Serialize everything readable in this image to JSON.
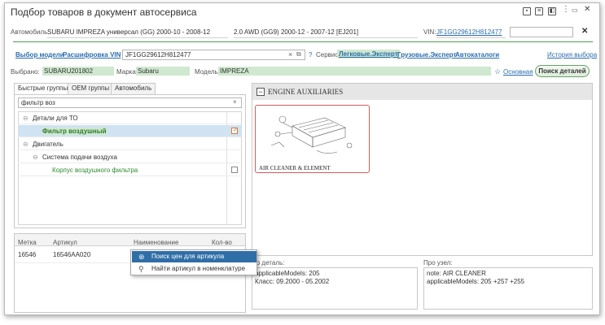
{
  "window": {
    "title": "Подбор товаров в документ автосервиса",
    "close_glyph": "✕"
  },
  "vehicle_row": {
    "car_label": "Автомобиль:",
    "car_value": "SUBARU IMPREZA универсал (GG) 2000-10 - 2008-12",
    "engine_value": "2.0 AWD (GG9) 2000-12 - 2007-12 [EJ201]",
    "vin_label": "VIN:",
    "vin_value": "JF1GG29612H812477",
    "close_glyph": "✕"
  },
  "search_row": {
    "select_model": "Выбор модели",
    "decode_vin": "Расшифровка VIN",
    "vin_input": "JF1GG29612H812477",
    "question": "?",
    "service_label": "Сервис:",
    "service_light": "Легковые.Эксперт",
    "service_trucks": "Грузовые.Эксперт",
    "autocatalogs": "Автокаталоги",
    "history": "История выбора"
  },
  "selection_row": {
    "chosen_label": "Выбрано:",
    "chosen_value": "SUBARU201802",
    "brand_label": "Марка:",
    "brand_value": "Subaru",
    "model_label": "Модель:",
    "model_value": "IMPREZA",
    "main_label": "Основная",
    "search_parts": "Поиск деталей"
  },
  "tabs": [
    {
      "label": "Быстрые группы"
    },
    {
      "label": "OEM группы"
    },
    {
      "label": "Автомобиль"
    }
  ],
  "filter": {
    "value": "фильтр воз",
    "clear_glyph": "×"
  },
  "tree": [
    {
      "label": "Детали для ТО",
      "checked": false
    },
    {
      "label": "Фильтр воздушный",
      "checked": true
    },
    {
      "label": "Двигатель",
      "checked": false
    },
    {
      "label": "Система подачи воздуха",
      "checked": false
    },
    {
      "label": "Корпус воздушного фильтра",
      "checked": false
    }
  ],
  "table": {
    "headers": [
      "Метка",
      "Артикул",
      "Наименование",
      "Кол-во"
    ],
    "rows": [
      {
        "mark": "16546",
        "article": "16546AA020"
      }
    ]
  },
  "context_menu": [
    {
      "label": "Поиск цен для артикула",
      "icon": "price-search-icon"
    },
    {
      "label": "Найти артикул в номенклатуре",
      "icon": "magnifier-icon"
    }
  ],
  "catalog": {
    "group_title": "ENGINE AUXILIARIES",
    "collapse_glyph": "−",
    "card_title": "AIR CLEANER & ELEMENT"
  },
  "detail_info": {
    "label": "По деталь:",
    "line1": "applicableModels: 205",
    "line2": "Класс: 09.2000 - 05.2002"
  },
  "node_info": {
    "label": "Про узел:",
    "line1": "note: AIR CLEANER",
    "line2": "applicableModels: 205 +257 +255"
  },
  "colors": {
    "accent_green": "#4aa14a",
    "link_blue": "#2a6db0",
    "selection_blue": "#2f6ea7",
    "card_border": "#d65a5a"
  }
}
